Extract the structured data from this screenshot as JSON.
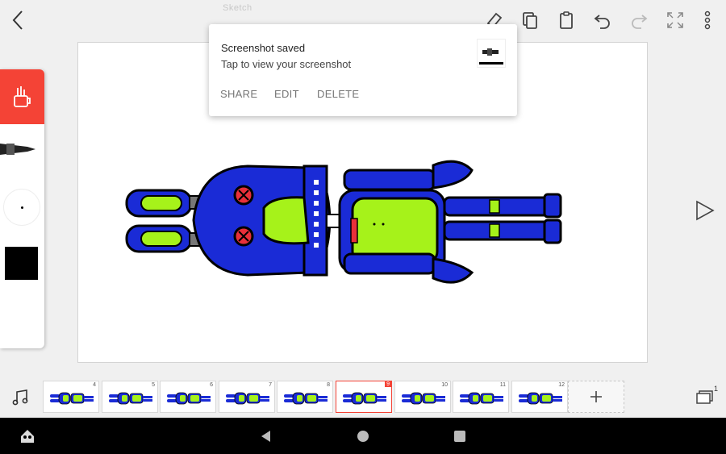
{
  "status_bar": {
    "faint_title": "Sketch"
  },
  "toolbar": {
    "icons": [
      "back-icon",
      "eraser-icon",
      "copy-icon",
      "paste-icon",
      "undo-icon",
      "redo-icon",
      "fullscreen-icon",
      "more-icon"
    ]
  },
  "toast": {
    "title": "Screenshot saved",
    "subtitle": "Tap to view your screenshot",
    "share_label": "SHARE",
    "edit_label": "EDIT",
    "delete_label": "DELETE"
  },
  "tool_panel": {
    "active_tool": "pen-cup",
    "current_color": "#000000"
  },
  "filmstrip": {
    "frames": [
      {
        "number": "4",
        "active": false
      },
      {
        "number": "5",
        "active": false
      },
      {
        "number": "6",
        "active": false
      },
      {
        "number": "7",
        "active": false
      },
      {
        "number": "8",
        "active": false
      },
      {
        "number": "9",
        "active": true
      },
      {
        "number": "10",
        "active": false
      },
      {
        "number": "11",
        "active": false
      },
      {
        "number": "12",
        "active": false
      }
    ],
    "layer_count": "1"
  },
  "colors": {
    "accent": "#f44336",
    "robot_blue": "#1a2bd6",
    "robot_green": "#a6f21a",
    "robot_red": "#e8303a"
  }
}
